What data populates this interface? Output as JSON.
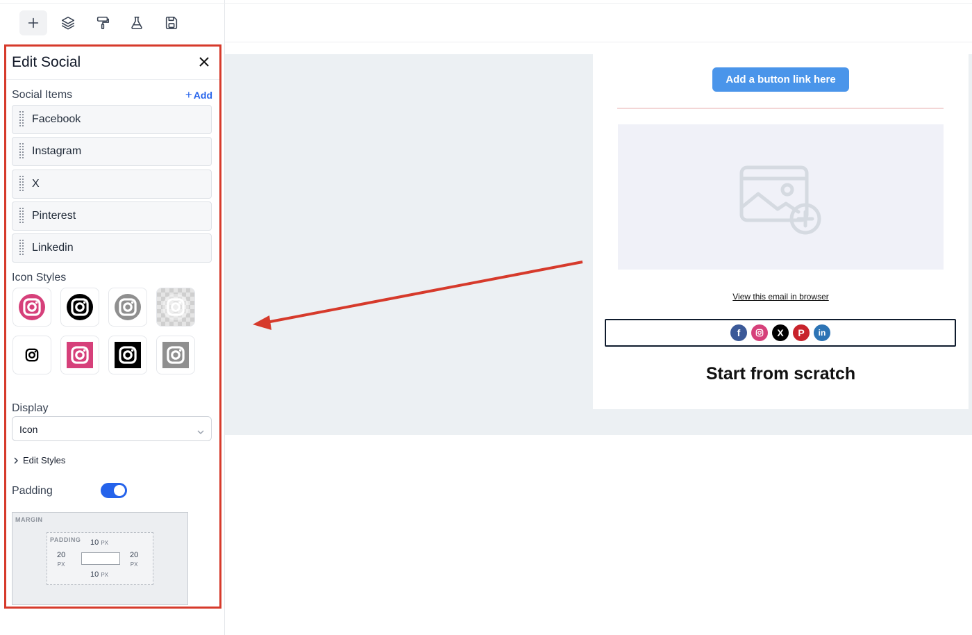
{
  "toolbar": {
    "buttons": [
      {
        "name": "add-icon",
        "active": true
      },
      {
        "name": "layers-icon",
        "active": false
      },
      {
        "name": "paint-roller-icon",
        "active": false
      },
      {
        "name": "flask-icon",
        "active": false
      },
      {
        "name": "save-icon",
        "active": false
      }
    ]
  },
  "panel": {
    "title": "Edit Social",
    "social_items_label": "Social Items",
    "add_label": "Add",
    "social_items": [
      "Facebook",
      "Instagram",
      "X",
      "Pinterest",
      "Linkedin"
    ],
    "icon_styles_label": "Icon Styles",
    "icon_styles": [
      {
        "shape": "circle",
        "color": "#d6407a"
      },
      {
        "shape": "circle",
        "color": "#000000"
      },
      {
        "shape": "circle",
        "color": "#8f8f8f"
      },
      {
        "shape": "circle",
        "color": "transparent"
      },
      {
        "shape": "plain",
        "color": "#000000"
      },
      {
        "shape": "square",
        "color": "#d6407a"
      },
      {
        "shape": "square",
        "color": "#000000"
      },
      {
        "shape": "square",
        "color": "#8f8f8f"
      }
    ],
    "display_label": "Display",
    "display_value": "Icon",
    "edit_styles_label": "Edit Styles",
    "padding_label": "Padding",
    "padding_enabled": true,
    "spacing": {
      "margin_label": "MARGIN",
      "padding_label": "PADDING",
      "top": "10",
      "right": "20",
      "bottom": "10",
      "left": "20",
      "unit": "PX"
    }
  },
  "email": {
    "button_label": "Add a button link here",
    "view_in_browser": "View this email in browser",
    "headline": "Start from scratch",
    "social_icons": [
      {
        "name": "facebook",
        "glyph": "f",
        "color": "#3b5998"
      },
      {
        "name": "instagram",
        "glyph": "",
        "color": "#d6407a"
      },
      {
        "name": "x",
        "glyph": "X",
        "color": "#000000"
      },
      {
        "name": "pinterest",
        "glyph": "P",
        "color": "#c8232c"
      },
      {
        "name": "linkedin",
        "glyph": "in",
        "color": "#2d74b5"
      }
    ]
  },
  "colors": {
    "annotation": "#d63a2b",
    "accent": "#2563eb",
    "cta": "#4a95ea"
  }
}
